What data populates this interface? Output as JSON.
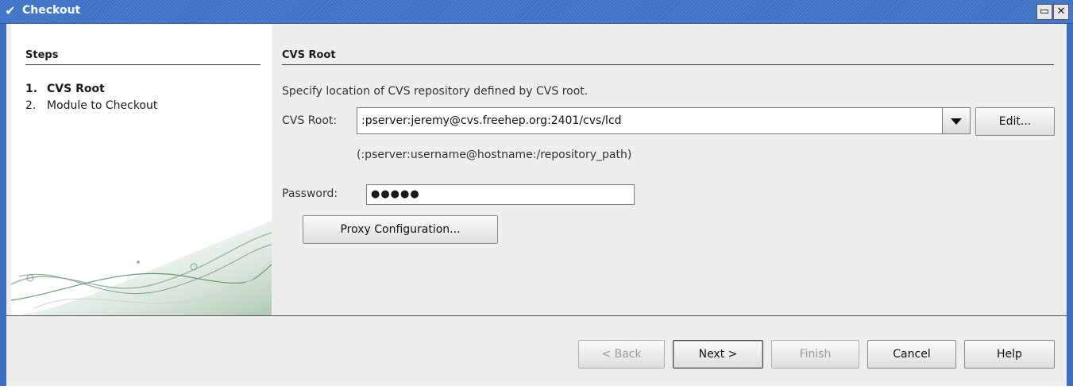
{
  "window": {
    "title": "Checkout"
  },
  "steps": {
    "header": "Steps",
    "items": [
      {
        "number": "1.",
        "label": "CVS Root",
        "active": true
      },
      {
        "number": "2.",
        "label": "Module to Checkout",
        "active": false
      }
    ]
  },
  "main": {
    "header": "CVS Root",
    "description": "Specify location of CVS repository defined by CVS root.",
    "cvs_root_label": "CVS Root:",
    "cvs_root_value": ":pserver:jeremy@cvs.freehep.org:2401/cvs/lcd",
    "edit_button": "Edit...",
    "format_hint": "(:pserver:username@hostname:/repository_path)",
    "password_label": "Password:",
    "password_value": "●●●●●",
    "proxy_button": "Proxy Configuration..."
  },
  "buttons": {
    "back": "< Back",
    "next": "Next >",
    "finish": "Finish",
    "cancel": "Cancel",
    "help": "Help"
  },
  "colors": {
    "titlebar": "#3f71c3",
    "panel": "#eeeeee",
    "decoration": "#6a9a74"
  }
}
